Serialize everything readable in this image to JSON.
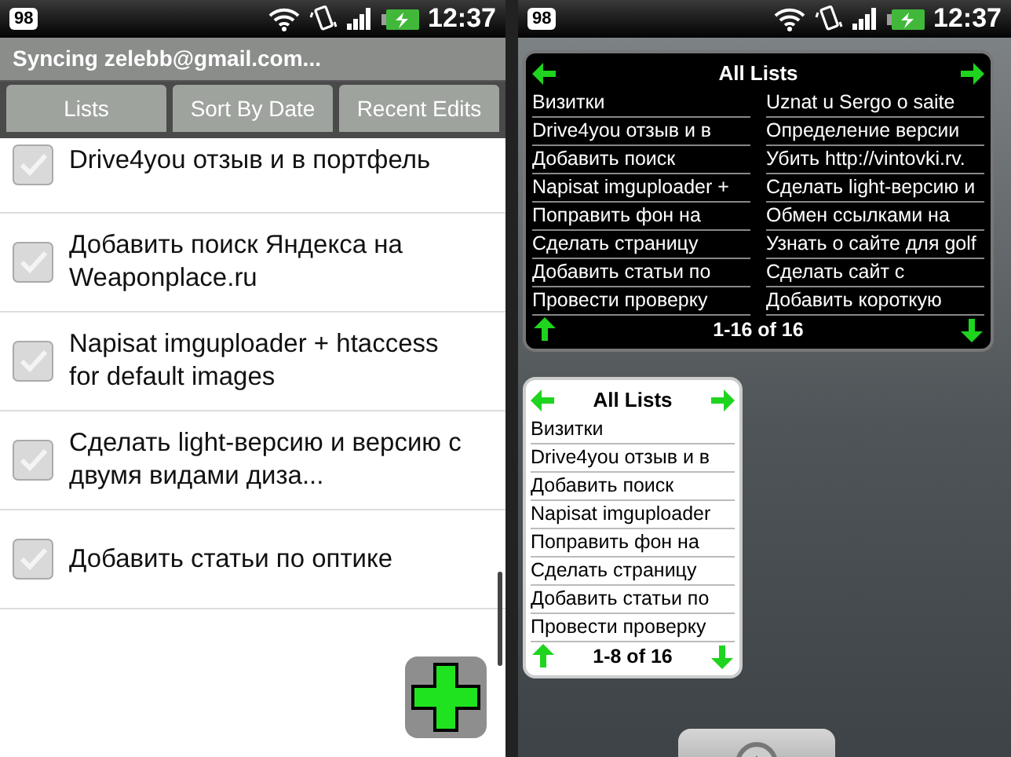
{
  "left_screen": {
    "status_bar": {
      "badge": "98",
      "time": "12:37"
    },
    "title_bar": {
      "title": "Syncing zelebb@gmail.com..."
    },
    "tabs": [
      {
        "label": "Lists",
        "selected": false
      },
      {
        "label": "Sort By Date",
        "selected": false
      },
      {
        "label": "Recent Edits",
        "selected": false
      }
    ],
    "tasks": [
      {
        "text": "Drive4you отзыв и в портфель",
        "checked": false
      },
      {
        "text": "Добавить поиск Яндекса на Weaponplace.ru",
        "checked": false
      },
      {
        "text": "Napisat imguploader + htaccess for default images",
        "checked": false
      },
      {
        "text": "Сделать light-версию и версию с двумя видами диза...",
        "checked": false
      },
      {
        "text": "Добавить статьи по оптике",
        "checked": false
      }
    ]
  },
  "right_screen": {
    "status_bar": {
      "badge": "98",
      "time": "12:37"
    },
    "widgets": [
      {
        "kind": "dark",
        "title": "All Lists",
        "pager": "1-16 of 16",
        "items": [
          "Визитки",
          "Drive4you отзыв и в",
          "Добавить поиск",
          "Napisat imguploader +",
          "Поправить фон на",
          "Сделать страницу",
          "Добавить статьи по",
          "Провести проверку",
          "Uznat u Sergo o saite",
          "Определение версии",
          "Убить http://vintovki.rv.",
          "Сделать light-версию и",
          "Обмен ссылками на",
          "Узнать о сайте для golf",
          "Сделать сайт с",
          "Добавить короткую"
        ]
      },
      {
        "kind": "light",
        "title": "All Lists",
        "pager": "1-8 of 16",
        "items": [
          "Визитки",
          "Drive4you отзыв и в",
          "Добавить поиск",
          "Napisat imguploader",
          "Поправить фон на",
          "Сделать страницу",
          "Добавить статьи по",
          "Провести проверку"
        ]
      }
    ]
  }
}
